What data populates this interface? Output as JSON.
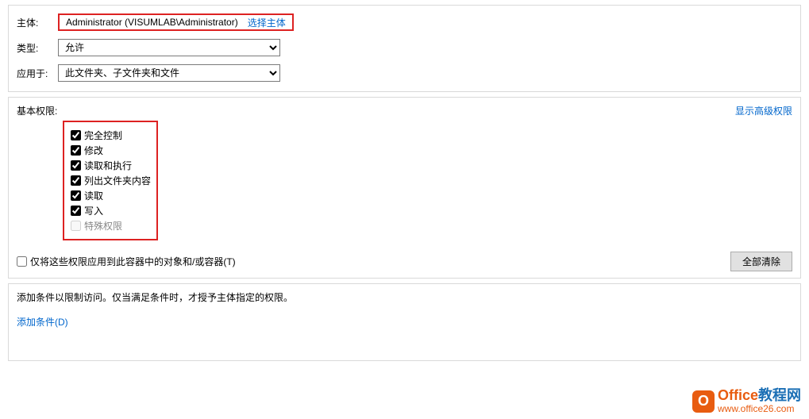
{
  "labels": {
    "principal": "主体:",
    "type": "类型:",
    "applyTo": "应用于:"
  },
  "principal": {
    "name": "Administrator (VISUMLAB\\Administrator)",
    "selectLink": "选择主体"
  },
  "typeSelect": {
    "value": "允许"
  },
  "applyToSelect": {
    "value": "此文件夹、子文件夹和文件"
  },
  "permissions": {
    "title": "基本权限:",
    "advancedLink": "显示高级权限",
    "items": [
      {
        "label": "完全控制",
        "checked": true,
        "disabled": false
      },
      {
        "label": "修改",
        "checked": true,
        "disabled": false
      },
      {
        "label": "读取和执行",
        "checked": true,
        "disabled": false
      },
      {
        "label": "列出文件夹内容",
        "checked": true,
        "disabled": false
      },
      {
        "label": "读取",
        "checked": true,
        "disabled": false
      },
      {
        "label": "写入",
        "checked": true,
        "disabled": false
      },
      {
        "label": "特殊权限",
        "checked": false,
        "disabled": true
      }
    ]
  },
  "applyOnly": {
    "label": "仅将这些权限应用到此容器中的对象和/或容器(T)",
    "checked": false
  },
  "clearAllBtn": "全部清除",
  "conditions": {
    "text": "添加条件以限制访问。仅当满足条件时，才授予主体指定的权限。",
    "addLink": "添加条件(D)"
  },
  "watermark": {
    "brand": "Office教程网",
    "url": "www.office26.com"
  }
}
